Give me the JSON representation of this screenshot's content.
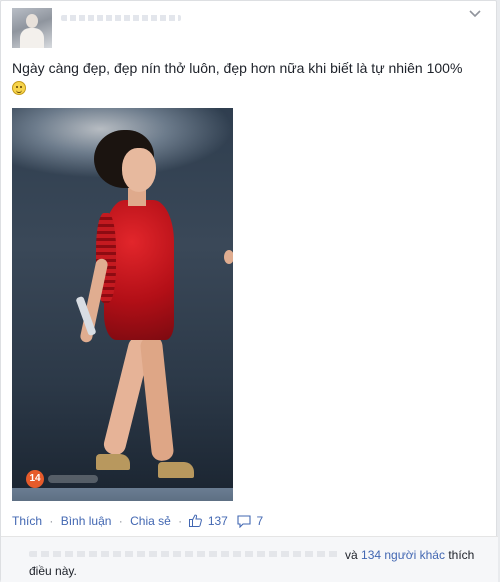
{
  "post": {
    "text": "Ngày càng đẹp, đẹp nín thở luôn, đẹp hơn nữa khi biết là tự nhiên 100%",
    "emoji": "smile-emoji"
  },
  "photo": {
    "watermark": "14"
  },
  "actions": {
    "like_label": "Thích",
    "comment_label": "Bình luận",
    "share_label": "Chia sẻ",
    "like_count": "137",
    "comment_count": "7",
    "separator": "·"
  },
  "likes_summary": {
    "prefix": "và",
    "others_link": "134 người khác",
    "suffix": "thích",
    "line2": "điều này."
  },
  "colors": {
    "link": "#4267b2",
    "text": "#1d2129",
    "muted": "#90949c"
  }
}
